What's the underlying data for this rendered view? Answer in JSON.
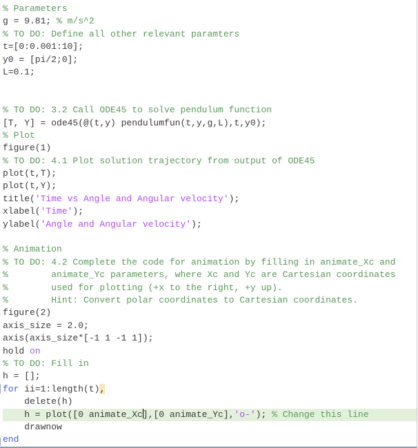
{
  "editor": {
    "language": "matlab",
    "lines": [
      {
        "segments": [
          {
            "t": "comment",
            "v": "% Parameters"
          }
        ]
      },
      {
        "segments": [
          {
            "t": "code",
            "v": "g = 9.81; "
          },
          {
            "t": "comment",
            "v": "% m/s^2"
          }
        ]
      },
      {
        "segments": [
          {
            "t": "comment",
            "v": "% TO DO: Define all other relevant paramters"
          }
        ]
      },
      {
        "segments": [
          {
            "t": "code",
            "v": "t="
          },
          {
            "t": "code-underline",
            "v": "["
          },
          {
            "t": "code",
            "v": "0:0.001:10];"
          }
        ]
      },
      {
        "segments": [
          {
            "t": "code",
            "v": "y0 = [pi/2;0];"
          }
        ]
      },
      {
        "segments": [
          {
            "t": "code",
            "v": "L=0.1;"
          }
        ]
      },
      {
        "segments": []
      },
      {
        "segments": []
      },
      {
        "segments": [
          {
            "t": "comment",
            "v": "% TO DO: 3.2 Call ODE45 to solve pendulum function"
          }
        ]
      },
      {
        "segments": [
          {
            "t": "code",
            "v": "[T, Y] = ode45(@(t,y) pendulumfun(t,y,g,L),t,y0);"
          }
        ]
      },
      {
        "segments": [
          {
            "t": "comment",
            "v": "% Plot"
          }
        ]
      },
      {
        "segments": [
          {
            "t": "code",
            "v": "figure(1)"
          }
        ]
      },
      {
        "segments": [
          {
            "t": "comment",
            "v": "% TO DO: 4.1 Plot solution trajectory from output of ODE45"
          }
        ]
      },
      {
        "segments": [
          {
            "t": "code",
            "v": "plot(t,T);"
          }
        ]
      },
      {
        "segments": [
          {
            "t": "code",
            "v": "plot(t,Y);"
          }
        ]
      },
      {
        "segments": [
          {
            "t": "code",
            "v": "title("
          },
          {
            "t": "string",
            "v": "'Time vs Angle and Angular velocity'"
          },
          {
            "t": "code",
            "v": ");"
          }
        ]
      },
      {
        "segments": [
          {
            "t": "code",
            "v": "xlabel("
          },
          {
            "t": "string",
            "v": "'Time'"
          },
          {
            "t": "code",
            "v": ");"
          }
        ]
      },
      {
        "segments": [
          {
            "t": "code",
            "v": "ylabel("
          },
          {
            "t": "string",
            "v": "'Angle and Angular velocity'"
          },
          {
            "t": "code",
            "v": ");"
          }
        ]
      },
      {
        "segments": []
      },
      {
        "segments": [
          {
            "t": "comment",
            "v": "% Animation"
          }
        ]
      },
      {
        "segments": [
          {
            "t": "comment",
            "v": "% TO DO: 4.2 Complete the code for animation by filling in animate_Xc and"
          }
        ]
      },
      {
        "segments": [
          {
            "t": "comment",
            "v": "%        animate_Yc parameters, where Xc and Yc are Cartesian coordinates"
          }
        ]
      },
      {
        "segments": [
          {
            "t": "comment",
            "v": "%        used for plotting (+x to the right, +y up)."
          }
        ]
      },
      {
        "segments": [
          {
            "t": "comment",
            "v": "%        Hint: Convert polar coordinates to Cartesian coordinates."
          }
        ]
      },
      {
        "segments": [
          {
            "t": "code",
            "v": "figure(2)"
          }
        ]
      },
      {
        "segments": [
          {
            "t": "code",
            "v": "axis_size = 2.0;"
          }
        ]
      },
      {
        "segments": [
          {
            "t": "code",
            "v": "axis(axis_size*[-1 1 -1 1]);"
          }
        ]
      },
      {
        "segments": [
          {
            "t": "code",
            "v": "hold "
          },
          {
            "t": "keyword-soft",
            "v": "on"
          }
        ]
      },
      {
        "segments": [
          {
            "t": "comment",
            "v": "% TO DO: Fill in"
          }
        ]
      },
      {
        "segments": [
          {
            "t": "code",
            "v": "h = [];"
          }
        ]
      },
      {
        "segments": [
          {
            "t": "keyword",
            "v": "for"
          },
          {
            "t": "code",
            "v": " ii=1:length(t)"
          },
          {
            "t": "code-yellow",
            "v": ","
          }
        ]
      },
      {
        "segments": [
          {
            "t": "code",
            "v": "    delete(h)"
          }
        ]
      },
      {
        "highlighted": true,
        "segments": [
          {
            "t": "code",
            "v": "    h = plot([0 animate_Xc"
          },
          {
            "t": "cursor",
            "v": ""
          },
          {
            "t": "code",
            "v": "],[0 animate_Yc],"
          },
          {
            "t": "string",
            "v": "'o-'"
          },
          {
            "t": "code",
            "v": "); "
          },
          {
            "t": "comment",
            "v": "% Change this line"
          }
        ]
      },
      {
        "segments": [
          {
            "t": "code",
            "v": "    drawnow"
          }
        ]
      },
      {
        "segments": [
          {
            "t": "keyword",
            "v": "end"
          }
        ]
      }
    ]
  }
}
